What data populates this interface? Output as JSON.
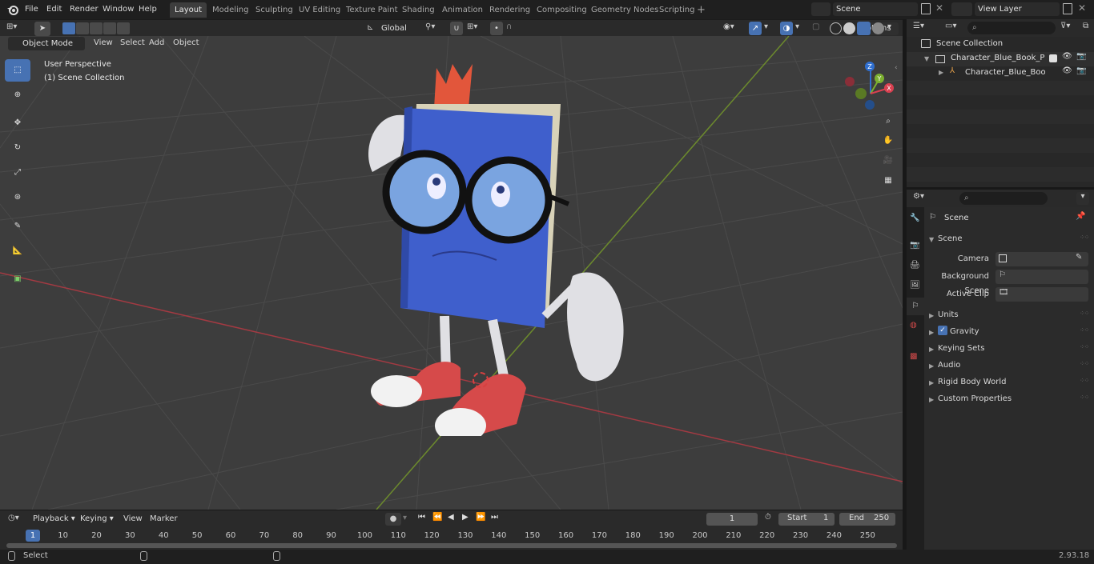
{
  "menu": {
    "file": "File",
    "edit": "Edit",
    "render": "Render",
    "window": "Window",
    "help": "Help"
  },
  "workspaces": [
    "Layout",
    "Modeling",
    "Sculpting",
    "UV Editing",
    "Texture Paint",
    "Shading",
    "Animation",
    "Rendering",
    "Compositing",
    "Geometry Nodes",
    "Scripting"
  ],
  "scene_selector": "Scene",
  "view_layer_selector": "View Layer",
  "viewport_header": {
    "mode": "Object Mode",
    "view": "View",
    "select": "Select",
    "add": "Add",
    "object": "Object",
    "transform_orientation": "Global",
    "options": "Options"
  },
  "viewport_overlay": {
    "perspective": "User Perspective",
    "collection": "(1) Scene Collection"
  },
  "gizmo_axes": {
    "x": "X",
    "y": "Y",
    "z": "Z"
  },
  "outliner": {
    "root": "Scene Collection",
    "items": [
      {
        "label": "Character_Blue_Book_Puzzler"
      },
      {
        "label": "Character_Blue_Book_Pu"
      }
    ]
  },
  "properties": {
    "context": "Scene",
    "panel": "Scene",
    "fields": [
      {
        "label": "Camera"
      },
      {
        "label": "Background Scene"
      },
      {
        "label": "Active Clip"
      }
    ],
    "sections": [
      "Units",
      "Gravity",
      "Keying Sets",
      "Audio",
      "Rigid Body World",
      "Custom Properties"
    ]
  },
  "timeline": {
    "playback": "Playback",
    "keying": "Keying",
    "view": "View",
    "marker": "Marker",
    "current_frame": "1",
    "start_label": "Start",
    "start_value": "1",
    "end_label": "End",
    "end_value": "250",
    "ruler": [
      "1",
      "10",
      "20",
      "30",
      "40",
      "50",
      "60",
      "70",
      "80",
      "90",
      "100",
      "110",
      "120",
      "130",
      "140",
      "150",
      "160",
      "170",
      "180",
      "190",
      "200",
      "210",
      "220",
      "230",
      "240",
      "250"
    ]
  },
  "status": {
    "select": "Select",
    "version": "2.93.18"
  },
  "colors": {
    "accent": "#4772b3",
    "grid_x_axis": "#a33a42",
    "grid_y_axis": "#6c8a2d",
    "book_blue": "#3f5fcc"
  }
}
